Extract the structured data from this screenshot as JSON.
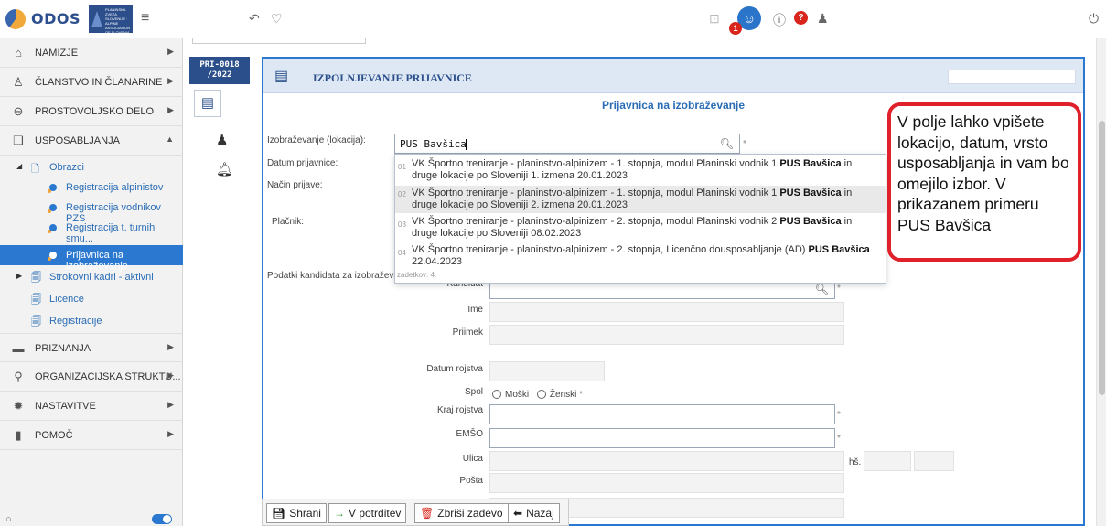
{
  "brand": {
    "name": "ODOS",
    "badge_text": "PLANINSKA ZVEZA SLOVENIJE · ALPINE ASSOCIATION OF SLOVENIA"
  },
  "sidebar": {
    "items": [
      {
        "label": "NAMIZJE",
        "icon": "home-icon"
      },
      {
        "label": "ČLANSTVO IN ČLANARINE",
        "icon": "person-icon"
      },
      {
        "label": "PROSTOVOLJSKO DELO",
        "icon": "globe-icon"
      },
      {
        "label": "USPOSABLJANJA",
        "icon": "book-icon"
      },
      {
        "label": "PRIZNANJA",
        "icon": "folder-icon"
      },
      {
        "label": "ORGANIZACIJSKA STRUKTU...",
        "icon": "org-icon"
      },
      {
        "label": "NASTAVITVE",
        "icon": "gear-icon"
      },
      {
        "label": "POMOČ",
        "icon": "help-icon"
      }
    ],
    "sub": {
      "obrazci": "Obrazci",
      "forms": [
        "Registracija alpinistov",
        "Registracija vodnikov PZS",
        "Registracija t. turnih smu...",
        "Prijavnica na izobraževanje"
      ],
      "strokovni": "Strokovni kadri - aktivni",
      "licence": "Licence",
      "registracije": "Registracije"
    }
  },
  "document": {
    "number": "PRI-0018 /2022"
  },
  "panel": {
    "title": "IZPOLNJEVANJE PRIJAVNICE",
    "form_title": "Prijavnica na izobraževanje"
  },
  "form": {
    "izobrazevanje_label": "Izobraževanje (lokacija):",
    "izobrazevanje_value": "PUS Bavšica",
    "datum_label": "Datum prijavnice:",
    "nacin_label": "Način prijave:",
    "placnik_label": "Plačnik:",
    "podatki_label": "Podatki kandidata za izobraževanje:",
    "kandidat_label": "Kandidat",
    "ime_label": "Ime",
    "priimek_label": "Priimek",
    "datum_rojstva_label": "Datum rojstva",
    "spol_label": "Spol",
    "spol_m": "Moški",
    "spol_z": "Ženski",
    "kraj_label": "Kraj rojstva",
    "emso_label": "EMŠO",
    "ulica_label": "Ulica",
    "hs_label": "hš.",
    "posta_label": "Pošta",
    "required_mark": "*"
  },
  "dropdown": {
    "options": [
      {
        "num": "01",
        "text": "VK Športno treniranje - planinstvo-alpinizem - 1. stopnja, modul Planinski vodnik 1 ",
        "bold": "PUS Bavšica",
        "rest": " in druge lokacije po Sloveniji 1. izmena 20.01.2023"
      },
      {
        "num": "02",
        "text": "VK Športno treniranje - planinstvo-alpinizem - 1. stopnja, modul Planinski vodnik 1 ",
        "bold": "PUS Bavšica",
        "rest": " in druge lokacije po Sloveniji 2. izmena 20.01.2023"
      },
      {
        "num": "03",
        "text": "VK Športno treniranje - planinstvo-alpinizem - 2. stopnja, modul Planinski vodnik 2 ",
        "bold": "PUS Bavšica",
        "rest": " in druge lokacije po Sloveniji 08.02.2023"
      },
      {
        "num": "04",
        "text": "VK Športno treniranje - planinstvo-alpinizem - 2. stopnja, Licenčno dousposabljanje (AD) ",
        "bold": "PUS Bavšica",
        "rest": " 22.04.2023"
      }
    ],
    "count": "zadetkov: 4."
  },
  "callout": "V polje lahko vpišete lokacijo, datum, vrsto usposabljanja in vam bo omejilo izbor. V prikazanem primeru PUS Bavšica",
  "toolbar": {
    "save": "Shrani",
    "confirm": "V potrditev",
    "delete": "Zbriši zadevo",
    "back": "Nazaj"
  },
  "notifications": {
    "count": "1"
  },
  "colors": {
    "accent": "#2a78d0",
    "header": "#2b4f8a",
    "callout": "#e0202a"
  }
}
